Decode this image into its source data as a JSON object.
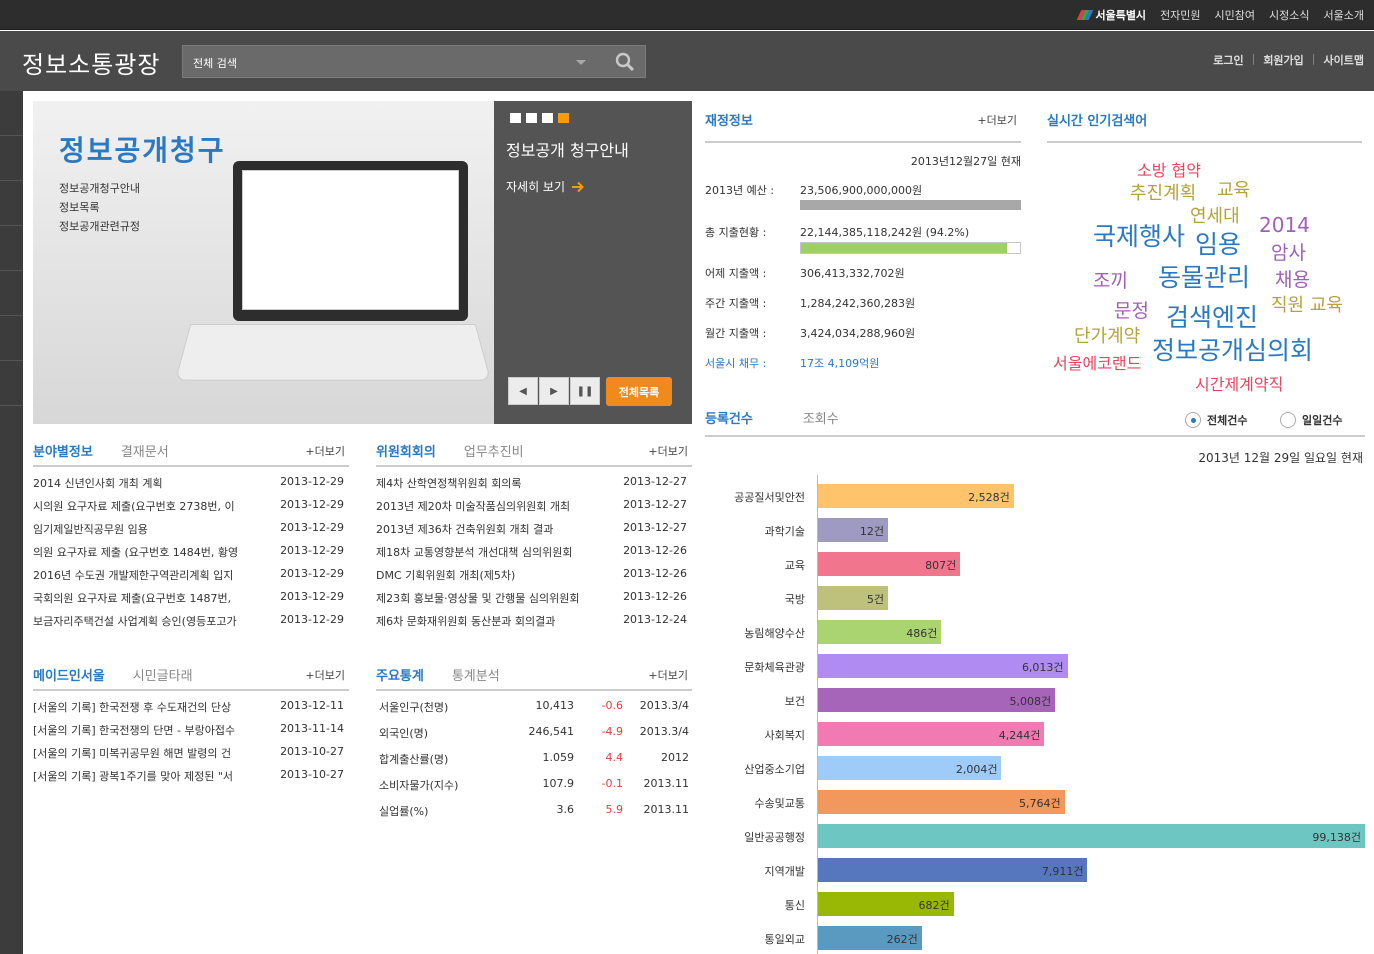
{
  "topbar": {
    "logo_text": "서울특별시",
    "links": [
      "전자민원",
      "시민참여",
      "시정소식",
      "서울소개"
    ]
  },
  "header": {
    "site_title": "정보소통광장",
    "search_placeholder": "전체 검색",
    "account_links": [
      "로그인",
      "회원가입",
      "사이트맵"
    ]
  },
  "banner": {
    "heading": "정보공개청구",
    "links": [
      "정보공개청구안내",
      "정보목록",
      "정보공개관련규정"
    ],
    "title": "정보공개 청구안내",
    "more_label": "자세히 보기",
    "all_list_label": "전체목록"
  },
  "finance": {
    "title": "재정정보",
    "more_label": "+더보기",
    "as_of": "2013년12월27일 현재",
    "rows": [
      {
        "label": "2013년 예산 :",
        "value": "23,506,900,000,000원"
      },
      {
        "label": "총 지출현황 :",
        "value": "22,144,385,118,242원 (94.2%)",
        "progress": 0.942
      },
      {
        "label": "어제 지출액 :",
        "value": "306,413,332,702원"
      },
      {
        "label": "주간 지출액 :",
        "value": "1,284,242,360,283원"
      },
      {
        "label": "월간 지출액 :",
        "value": "3,424,034,288,960원"
      },
      {
        "label": "서울시 채무 :",
        "value": "17조 4,109억원"
      }
    ]
  },
  "popular": {
    "title": "실시간 인기검색어",
    "keywords": [
      {
        "text": "소방 협약",
        "color": "#e8455e"
      },
      {
        "text": "추진계획",
        "color": "#b4a33a"
      },
      {
        "text": "교육",
        "color": "#b4a33a"
      },
      {
        "text": "연세대",
        "color": "#b4a33a"
      },
      {
        "text": "2014",
        "color": "#a060b8"
      },
      {
        "text": "국제행사",
        "color": "#2a79c3"
      },
      {
        "text": "임용",
        "color": "#2a79c3"
      },
      {
        "text": "암사",
        "color": "#a060b8"
      },
      {
        "text": "조끼",
        "color": "#a060b8"
      },
      {
        "text": "동물관리",
        "color": "#2a79c3"
      },
      {
        "text": "채용",
        "color": "#a060b8"
      },
      {
        "text": "문정",
        "color": "#a060b8"
      },
      {
        "text": "직원 교육",
        "color": "#b4a33a"
      },
      {
        "text": "검색엔진",
        "color": "#2a79c3"
      },
      {
        "text": "단가계약",
        "color": "#b4a33a"
      },
      {
        "text": "정보공개심의회",
        "color": "#2a79c3"
      },
      {
        "text": "서울에코랜드",
        "color": "#e8455e"
      },
      {
        "text": "시간제계약직",
        "color": "#e8455e"
      }
    ]
  },
  "field_info": {
    "tab_active": "분야별정보",
    "tab_inactive": "결재문서",
    "more_label": "+더보기",
    "items": [
      {
        "title": "2014 신년인사회 개최 계획",
        "date": "2013-12-29"
      },
      {
        "title": "시의원 요구자료 제출(요구번호 2738번, 이",
        "date": "2013-12-29"
      },
      {
        "title": "임기제일반직공무원 임용",
        "date": "2013-12-29"
      },
      {
        "title": "의원 요구자료 제출 (요구번호 1484번, 황영",
        "date": "2013-12-29"
      },
      {
        "title": "2016년 수도권 개발제한구역관리계획 입지",
        "date": "2013-12-29"
      },
      {
        "title": "국회의원 요구자료 제출(요구번호 1487번,",
        "date": "2013-12-29"
      },
      {
        "title": "보금자리주택건설 사업계획 승인(영등포고가",
        "date": "2013-12-29"
      }
    ]
  },
  "committee": {
    "tab_active": "위원회회의",
    "tab_inactive": "업무추진비",
    "more_label": "+더보기",
    "items": [
      {
        "title": "제4차 산학연정책위원회 회의록",
        "date": "2013-12-27"
      },
      {
        "title": "2013년 제20차 미술작품심의위원회 개최",
        "date": "2013-12-27"
      },
      {
        "title": "2013년 제36차 건축위원회 개최 결과",
        "date": "2013-12-27"
      },
      {
        "title": "제18차 교통영향분석 개선대책 심의위원회",
        "date": "2013-12-26"
      },
      {
        "title": "DMC 기획위원회 개최(제5차)",
        "date": "2013-12-26"
      },
      {
        "title": "제23회 홍보물·영상물 및 간행물 심의위원회",
        "date": "2013-12-26"
      },
      {
        "title": "제6차 문화재위원회 동산분과 회의결과",
        "date": "2013-12-24"
      }
    ]
  },
  "made_in_seoul": {
    "tab_active": "메이드인서울",
    "tab_inactive": "시민글타래",
    "more_label": "+더보기",
    "items": [
      {
        "title": "[서울의 기록] 한국전쟁 후 수도재건의 단상",
        "date": "2013-12-11"
      },
      {
        "title": "[서울의 기록] 한국전쟁의 단면 - 부랑아접수",
        "date": "2013-11-14"
      },
      {
        "title": "[서울의 기록] 미복귀공무원 해면 발령의 건",
        "date": "2013-10-27"
      },
      {
        "title": "[서울의 기록] 광복1주기를 맞아 제정된 \"서",
        "date": "2013-10-27"
      }
    ]
  },
  "stats": {
    "tab_active": "주요통계",
    "tab_inactive": "통계분석",
    "more_label": "+더보기",
    "items": [
      {
        "label": "서울인구(천명)",
        "value": "10,413",
        "change": "-0.6",
        "period": "2013.3/4"
      },
      {
        "label": "외국인(명)",
        "value": "246,541",
        "change": "-4.9",
        "period": "2013.3/4"
      },
      {
        "label": "합계출산률(명)",
        "value": "1.059",
        "change": "4.4",
        "period": "2012"
      },
      {
        "label": "소비자물가(지수)",
        "value": "107.9",
        "change": "-0.1",
        "period": "2013.11"
      },
      {
        "label": "실업률(%)",
        "value": "3.6",
        "change": "5.9",
        "period": "2013.11"
      }
    ]
  },
  "registration": {
    "tab_active": "등록건수",
    "tab_inactive": "조회수",
    "radio_all": "전체건수",
    "radio_daily": "일일건수",
    "as_of": "2013년 12월 29일 일요일 현재",
    "chart_data": {
      "type": "bar",
      "orientation": "horizontal",
      "categories": [
        "공공질서및안전",
        "과학기술",
        "교육",
        "국방",
        "농림해양수산",
        "문화체육관광",
        "보건",
        "사회복지",
        "산업중소기업",
        "수송및교통",
        "일반공공행정",
        "지역개발",
        "통신",
        "통일외교"
      ],
      "values": [
        2528,
        12,
        807,
        5,
        486,
        6013,
        5008,
        4244,
        2004,
        5764,
        99138,
        7911,
        682,
        262
      ],
      "value_labels": [
        "2,528건",
        "12건",
        "807건",
        "5건",
        "486건",
        "6,013건",
        "5,008건",
        "4,244건",
        "2,004건",
        "5,764건",
        "99,138건",
        "7,911건",
        "682건",
        "262건"
      ],
      "colors": [
        "#ffc46b",
        "#9f9ac2",
        "#f1768d",
        "#bdc17c",
        "#a9d46f",
        "#b08cf2",
        "#a665b8",
        "#f07ab1",
        "#9ecbf7",
        "#f2985c",
        "#6ec6c3",
        "#5677bd",
        "#99b805",
        "#5a9ac0"
      ],
      "scale": "nonlinear"
    }
  }
}
